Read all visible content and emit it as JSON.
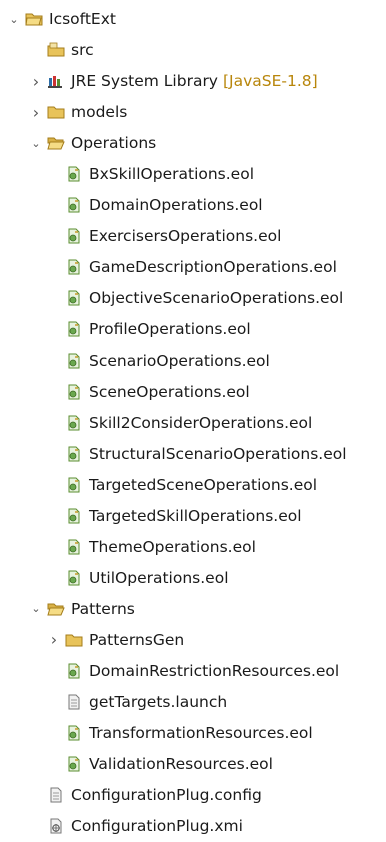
{
  "tree": {
    "project": {
      "label": "IcsoftExt",
      "icon": "project-folder-icon"
    },
    "items": [
      {
        "label": "src",
        "icon": "source-folder-icon",
        "level": 1,
        "twisty": ""
      },
      {
        "label": "JRE System Library",
        "decoration": "[JavaSE-1.8]",
        "icon": "library-icon",
        "level": 1,
        "twisty": "collapsed"
      },
      {
        "label": "models",
        "icon": "folder-icon",
        "level": 1,
        "twisty": "collapsed"
      },
      {
        "label": "Operations",
        "icon": "folder-open-icon",
        "level": 1,
        "twisty": "expanded"
      },
      {
        "label": "BxSkillOperations.eol",
        "icon": "eol-file-icon",
        "level": 2
      },
      {
        "label": "DomainOperations.eol",
        "icon": "eol-file-icon",
        "level": 2
      },
      {
        "label": "ExercisersOperations.eol",
        "icon": "eol-file-icon",
        "level": 2
      },
      {
        "label": "GameDescriptionOperations.eol",
        "icon": "eol-file-icon",
        "level": 2
      },
      {
        "label": "ObjectiveScenarioOperations.eol",
        "icon": "eol-file-icon",
        "level": 2
      },
      {
        "label": "ProfileOperations.eol",
        "icon": "eol-file-icon",
        "level": 2
      },
      {
        "label": "ScenarioOperations.eol",
        "icon": "eol-file-icon",
        "level": 2
      },
      {
        "label": "SceneOperations.eol",
        "icon": "eol-file-icon",
        "level": 2
      },
      {
        "label": "Skill2ConsiderOperations.eol",
        "icon": "eol-file-icon",
        "level": 2
      },
      {
        "label": "StructuralScenarioOperations.eol",
        "icon": "eol-file-icon",
        "level": 2
      },
      {
        "label": "TargetedSceneOperations.eol",
        "icon": "eol-file-icon",
        "level": 2
      },
      {
        "label": "TargetedSkillOperations.eol",
        "icon": "eol-file-icon",
        "level": 2
      },
      {
        "label": "ThemeOperations.eol",
        "icon": "eol-file-icon",
        "level": 2
      },
      {
        "label": "UtilOperations.eol",
        "icon": "eol-file-icon",
        "level": 2
      },
      {
        "label": "Patterns",
        "icon": "folder-open-icon",
        "level": 1,
        "twisty": "expanded"
      },
      {
        "label": "PatternsGen",
        "icon": "folder-icon",
        "level": 2,
        "twisty": "collapsed"
      },
      {
        "label": "DomainRestrictionResources.eol",
        "icon": "eol-file-icon",
        "level": 2
      },
      {
        "label": "getTargets.launch",
        "icon": "launch-file-icon",
        "level": 2
      },
      {
        "label": "TransformationResources.eol",
        "icon": "eol-file-icon",
        "level": 2
      },
      {
        "label": "ValidationResources.eol",
        "icon": "eol-file-icon",
        "level": 2
      },
      {
        "label": "ConfigurationPlug.config",
        "icon": "config-file-icon",
        "level": 1
      },
      {
        "label": "ConfigurationPlug.xmi",
        "icon": "xmi-file-icon",
        "level": 1
      }
    ]
  },
  "colors": {
    "folder": "#e8c35a",
    "eol": "#6aa84f",
    "decoration": "#b8860b",
    "twisty": "#555555"
  }
}
